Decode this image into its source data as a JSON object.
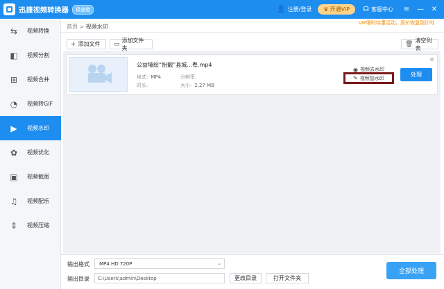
{
  "titlebar": {
    "app_title": "迅捷视频转换器",
    "badge": "极速版",
    "login_label": "注册/登录",
    "vip_label": "开通VIP",
    "service_label": "客服中心",
    "win_menu": "≡",
    "win_min": "—",
    "win_close": "✕"
  },
  "sidebar": {
    "items": [
      {
        "label": "视频转换",
        "icon": "convert-icon"
      },
      {
        "label": "视频分割",
        "icon": "split-icon"
      },
      {
        "label": "视频合并",
        "icon": "merge-icon"
      },
      {
        "label": "视频转GIF",
        "icon": "gif-icon"
      },
      {
        "label": "视频水印",
        "icon": "watermark-icon"
      },
      {
        "label": "视频优化",
        "icon": "optimize-icon"
      },
      {
        "label": "视频截图",
        "icon": "screenshot-icon"
      },
      {
        "label": "视频配乐",
        "icon": "music-icon"
      },
      {
        "label": "视频压缩",
        "icon": "compress-icon"
      }
    ],
    "active_index": 4
  },
  "breadcrumb": {
    "home": "首页",
    "sep": ">",
    "current": "视频水印"
  },
  "promo": "VIP限时特惠活动，原价恢复倒计时",
  "toolbar": {
    "add_file": "添加文件",
    "add_folder": "添加文件夹",
    "clear_list": "清空列表"
  },
  "file": {
    "name": "公益墙绘“扮靓”县城...粤.mp4",
    "format_label": "格式:",
    "format_value": "MP4",
    "resolution_label": "分辨率:",
    "resolution_value": "",
    "duration_label": "时长:",
    "duration_value": "",
    "size_label": "大小:",
    "size_value": "2.27 MB",
    "remove_watermark": "视频去水印",
    "add_watermark": "视频加水印",
    "process": "处理"
  },
  "bottom": {
    "format_label": "输出格式",
    "format_value": "MP4  HD 720P",
    "dir_label": "输出目录",
    "dir_value": "C:\\Users\\admin\\Desktop",
    "change_dir": "更改目录",
    "open_folder": "打开文件夹",
    "process_all": "全部处理"
  },
  "colors": {
    "accent": "#1d8ef0",
    "highlight_box": "#7a1a1a",
    "vip": "#ffd48a"
  }
}
